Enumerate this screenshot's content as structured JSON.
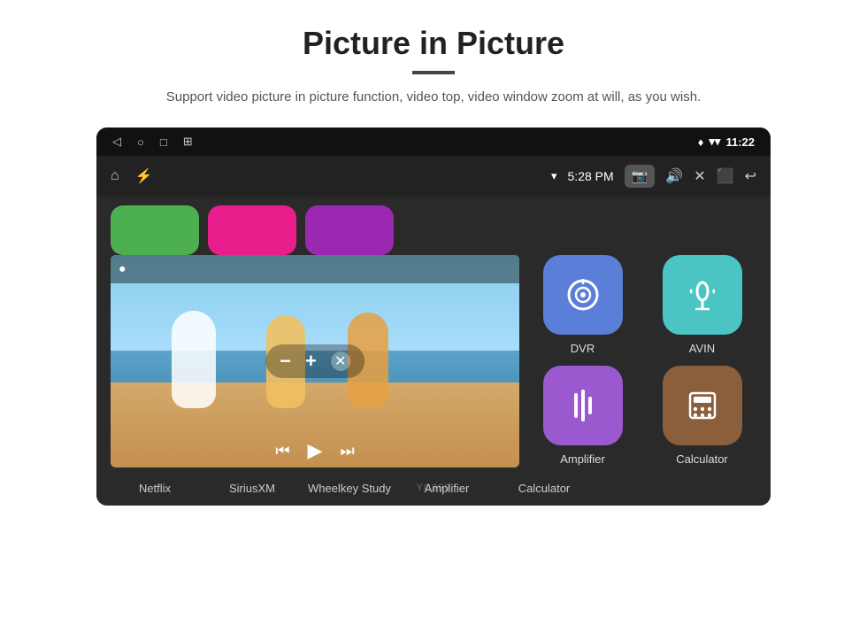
{
  "header": {
    "title": "Picture in Picture",
    "subtitle": "Support video picture in picture function, video top, video window zoom at will, as you wish."
  },
  "statusBar": {
    "time": "11:22",
    "navIcons": [
      "◁",
      "○",
      "□",
      "⊞"
    ]
  },
  "toolbar": {
    "homeIcon": "⌂",
    "usbIcon": "⚡",
    "wifiIcon": "▾",
    "time": "5:28 PM",
    "cameraIcon": "📷",
    "volumeIcon": "🔊",
    "closeIcon": "✕",
    "pipIcon": "⬛",
    "backIcon": "↩"
  },
  "pipVideo": {
    "recordIcon": "⏺",
    "minusLabel": "−",
    "plusLabel": "+",
    "closeIcon": "✕",
    "prevIcon": "⏮",
    "playIcon": "▶",
    "nextIcon": "⏭"
  },
  "appIconsTop": [
    {
      "color": "green",
      "label": ""
    },
    {
      "color": "pink",
      "label": ""
    },
    {
      "color": "purple",
      "label": ""
    }
  ],
  "appGrid": [
    {
      "id": "dvr",
      "colorClass": "app-icon-dvr",
      "icon": "📡",
      "label": "DVR"
    },
    {
      "id": "avin",
      "colorClass": "app-icon-avin",
      "icon": "🎛",
      "label": "AVIN"
    },
    {
      "id": "amplifier",
      "colorClass": "app-icon-amplifier",
      "icon": "🎚",
      "label": "Amplifier"
    },
    {
      "id": "calculator",
      "colorClass": "app-icon-calculator",
      "icon": "🔢",
      "label": "Calculator"
    }
  ],
  "bottomApps": [
    {
      "label": "Netflix"
    },
    {
      "label": "SiriusXM"
    },
    {
      "label": "Wheelkey Study"
    },
    {
      "label": "Amplifier"
    },
    {
      "label": "Calculator"
    }
  ],
  "watermark": "YC299"
}
